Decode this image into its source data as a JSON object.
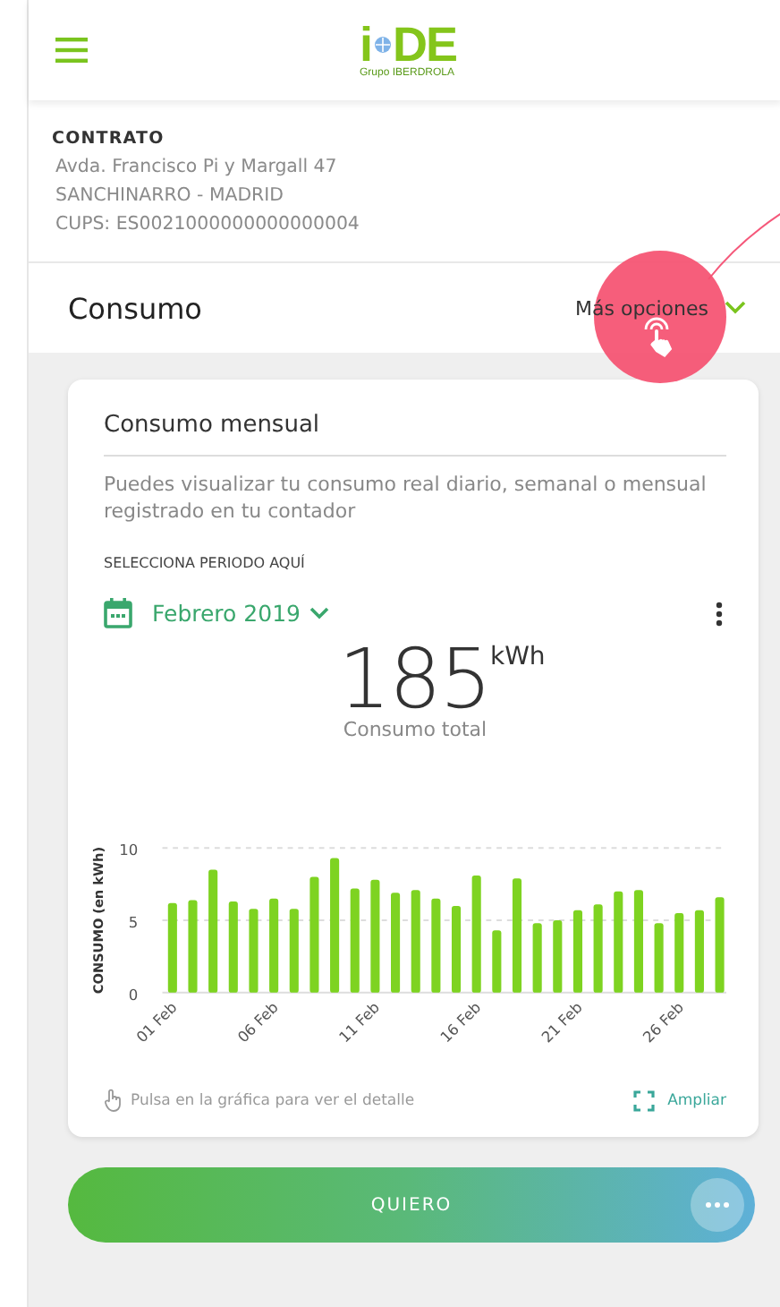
{
  "logo": {
    "left": "i",
    "right": "DE",
    "tagline": "Grupo IBERDROLA"
  },
  "contract": {
    "title": "CONTRATO",
    "lines": [
      "Avda. Francisco Pi y Margall 47",
      "SANCHINARRO - MADRID",
      "CUPS: ES0021000000000000004"
    ]
  },
  "section": {
    "title": "Consumo",
    "more_options": "Más opciones"
  },
  "card": {
    "title": "Consumo mensual",
    "description": "Puedes visualizar tu consumo real diario, semanal o mensual registrado en tu contador",
    "period_label": "SELECCIONA PERIODO AQUÍ",
    "period": "Febrero 2019",
    "total": {
      "value": "185",
      "unit": "kWh",
      "label": "Consumo total"
    },
    "chart_data": {
      "type": "bar",
      "ylabel": "CONSUMO (en kWh)",
      "categories": [
        "01 Feb",
        null,
        null,
        null,
        null,
        "06 Feb",
        null,
        null,
        null,
        null,
        "11 Feb",
        null,
        null,
        null,
        null,
        "16 Feb",
        null,
        null,
        null,
        null,
        "21 Feb",
        null,
        null,
        null,
        null,
        "26 Feb",
        null,
        null
      ],
      "ylim": [
        0,
        10
      ],
      "yticks": [
        0,
        5,
        10
      ],
      "series": [
        {
          "color": "#7ed321",
          "values": [
            6.2,
            6.4,
            8.5,
            6.3,
            5.8,
            6.5,
            5.8,
            8.0,
            9.3,
            7.2,
            7.8,
            6.9,
            7.1,
            6.5,
            6.0,
            8.1,
            4.3,
            7.9,
            4.8,
            5.0,
            5.7,
            6.1,
            7.0,
            7.1,
            4.8,
            5.5,
            5.7,
            6.6
          ]
        }
      ]
    },
    "hint": "Pulsa en la gráfica para ver el detalle",
    "expand": "Ampliar"
  },
  "cta": {
    "label": "QUIERO"
  }
}
